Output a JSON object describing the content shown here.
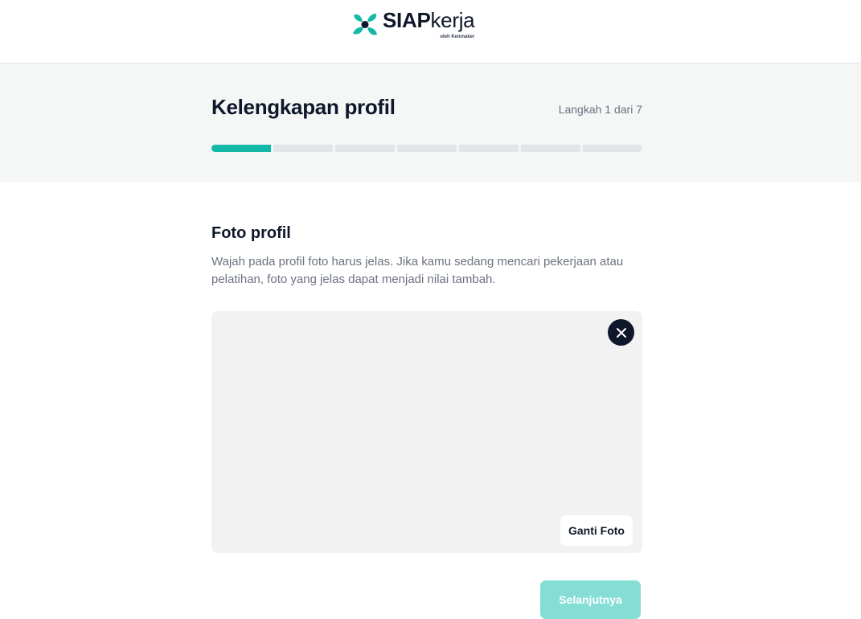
{
  "brand": {
    "name_bold": "SIAP",
    "name_light": "kerja",
    "tagline": "oleh Kemnaker",
    "logo_icon": "siapkerja-logo-icon",
    "primary_color": "#14b8a6",
    "dark_color": "#0f172a"
  },
  "header": {
    "title": "Kelengkapan profil",
    "step_text": "Langkah 1 dari 7",
    "progress": {
      "current_step": 1,
      "total_steps": 7
    }
  },
  "section": {
    "title": "Foto profil",
    "description": "Wajah pada profil foto harus jelas. Jika kamu sedang mencari pekerjaan atau pelatihan, foto yang jelas dapat menjadi nilai tambah."
  },
  "photo": {
    "remove_icon": "close-icon",
    "change_label": "Ganti Foto"
  },
  "actions": {
    "next_label": "Selanjutnya",
    "next_color": "#85ded5"
  }
}
